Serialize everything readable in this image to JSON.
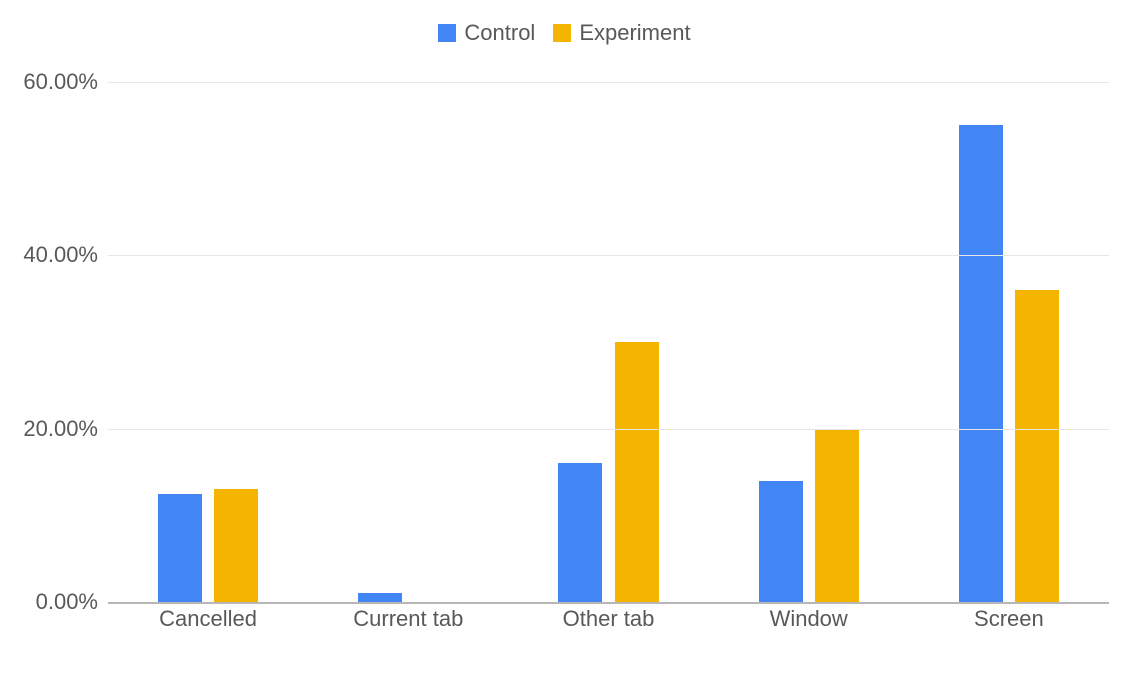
{
  "chart_data": {
    "type": "bar",
    "categories": [
      "Cancelled",
      "Current tab",
      "Other tab",
      "Window",
      "Screen"
    ],
    "series": [
      {
        "name": "Control",
        "color": "#4285f4",
        "values": [
          12.5,
          1.0,
          16.0,
          14.0,
          55.0
        ]
      },
      {
        "name": "Experiment",
        "color": "#f4b400",
        "values": [
          13.0,
          0.0,
          30.0,
          20.0,
          36.0
        ]
      }
    ],
    "ylim": [
      0,
      60
    ],
    "ytick_step": 20,
    "yformat": "percent_2dp",
    "title": "",
    "xlabel": "",
    "ylabel": "",
    "grid": true,
    "legend_position": "top"
  },
  "ytick_labels": [
    "0.00%",
    "20.00%",
    "40.00%",
    "60.00%"
  ]
}
